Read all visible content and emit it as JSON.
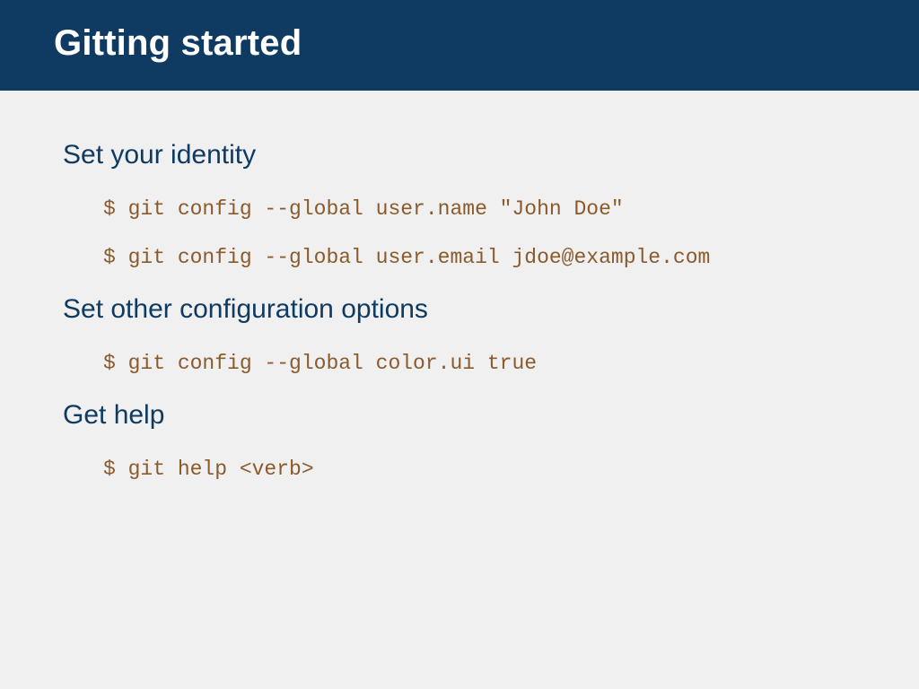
{
  "header": {
    "title": "Gitting started"
  },
  "sections": [
    {
      "heading": "Set your identity",
      "codes": [
        "$ git config --global user.name \"John Doe\"",
        "$ git config --global user.email jdoe@example.com"
      ]
    },
    {
      "heading": "Set other configuration options",
      "codes": [
        "$ git config --global color.ui true"
      ]
    },
    {
      "heading": "Get help",
      "codes": [
        "$ git help <verb>"
      ]
    }
  ]
}
